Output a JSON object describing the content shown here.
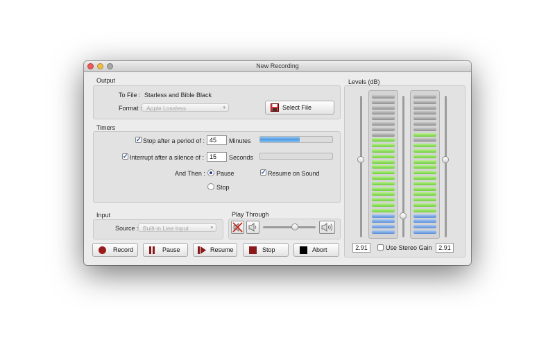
{
  "window": {
    "title": "New Recording"
  },
  "output": {
    "section_label": "Output",
    "to_file_label": "To File :",
    "to_file_value": "Starless and Bible Black",
    "format_label": "Format :",
    "format_value": "Apple Lossless",
    "select_file_label": "Select File",
    "select_file_icon": "floppy-disk-icon"
  },
  "timers": {
    "section_label": "Timers",
    "stop_after": {
      "checked": true,
      "label": "Stop after a period of :",
      "value": "45",
      "unit": "Minutes",
      "progress": 0.55
    },
    "interrupt": {
      "checked": true,
      "label": "Interrupt after a silence of :",
      "value": "15",
      "unit": "Seconds",
      "progress": 0.0
    },
    "and_then_label": "And Then :",
    "pause_label": "Pause",
    "stop_label": "Stop",
    "selected_action": "Pause",
    "resume_on_sound": {
      "checked": true,
      "label": "Resume on Sound"
    }
  },
  "input": {
    "section_label": "Input",
    "source_label": "Source :",
    "source_value": "Built-in Line Input"
  },
  "play_through": {
    "section_label": "Play Through",
    "volume_level": 0.6,
    "icons": [
      "speaker-muted-icon",
      "speaker-low-icon",
      "speaker-high-icon"
    ]
  },
  "buttons": {
    "record": "Record",
    "pause": "Pause",
    "resume": "Resume",
    "stop": "Stop",
    "abort": "Abort"
  },
  "levels": {
    "section_label": "Levels (dB)",
    "left_value": "2.91",
    "right_value": "2.91",
    "stereo_gain_label": "Use Stereo Gain",
    "stereo_gain_checked": false,
    "left_slider_level": 0.55,
    "right_slider_level": 0.55,
    "center_slider_level": 0.15,
    "left_segments": [
      "gray",
      "gray",
      "gray",
      "gray",
      "gray",
      "gray",
      "gray",
      "gray",
      "green",
      "green",
      "green",
      "green",
      "green",
      "green",
      "green",
      "green",
      "green",
      "green",
      "green",
      "green",
      "green",
      "green",
      "blue",
      "blue",
      "blue",
      "blue"
    ],
    "right_segments": [
      "gray",
      "gray",
      "gray",
      "gray",
      "gray",
      "gray",
      "gray",
      "green",
      "gray",
      "green",
      "green",
      "green",
      "green",
      "green",
      "green",
      "green",
      "green",
      "green",
      "green",
      "green",
      "green",
      "green",
      "blue",
      "blue",
      "blue",
      "blue"
    ]
  },
  "colors": {
    "progress_fill": "#4d9be2",
    "meter_green": "#6fcf3c",
    "meter_blue": "#5b8fd9",
    "record_red": "#9c1b1b"
  }
}
